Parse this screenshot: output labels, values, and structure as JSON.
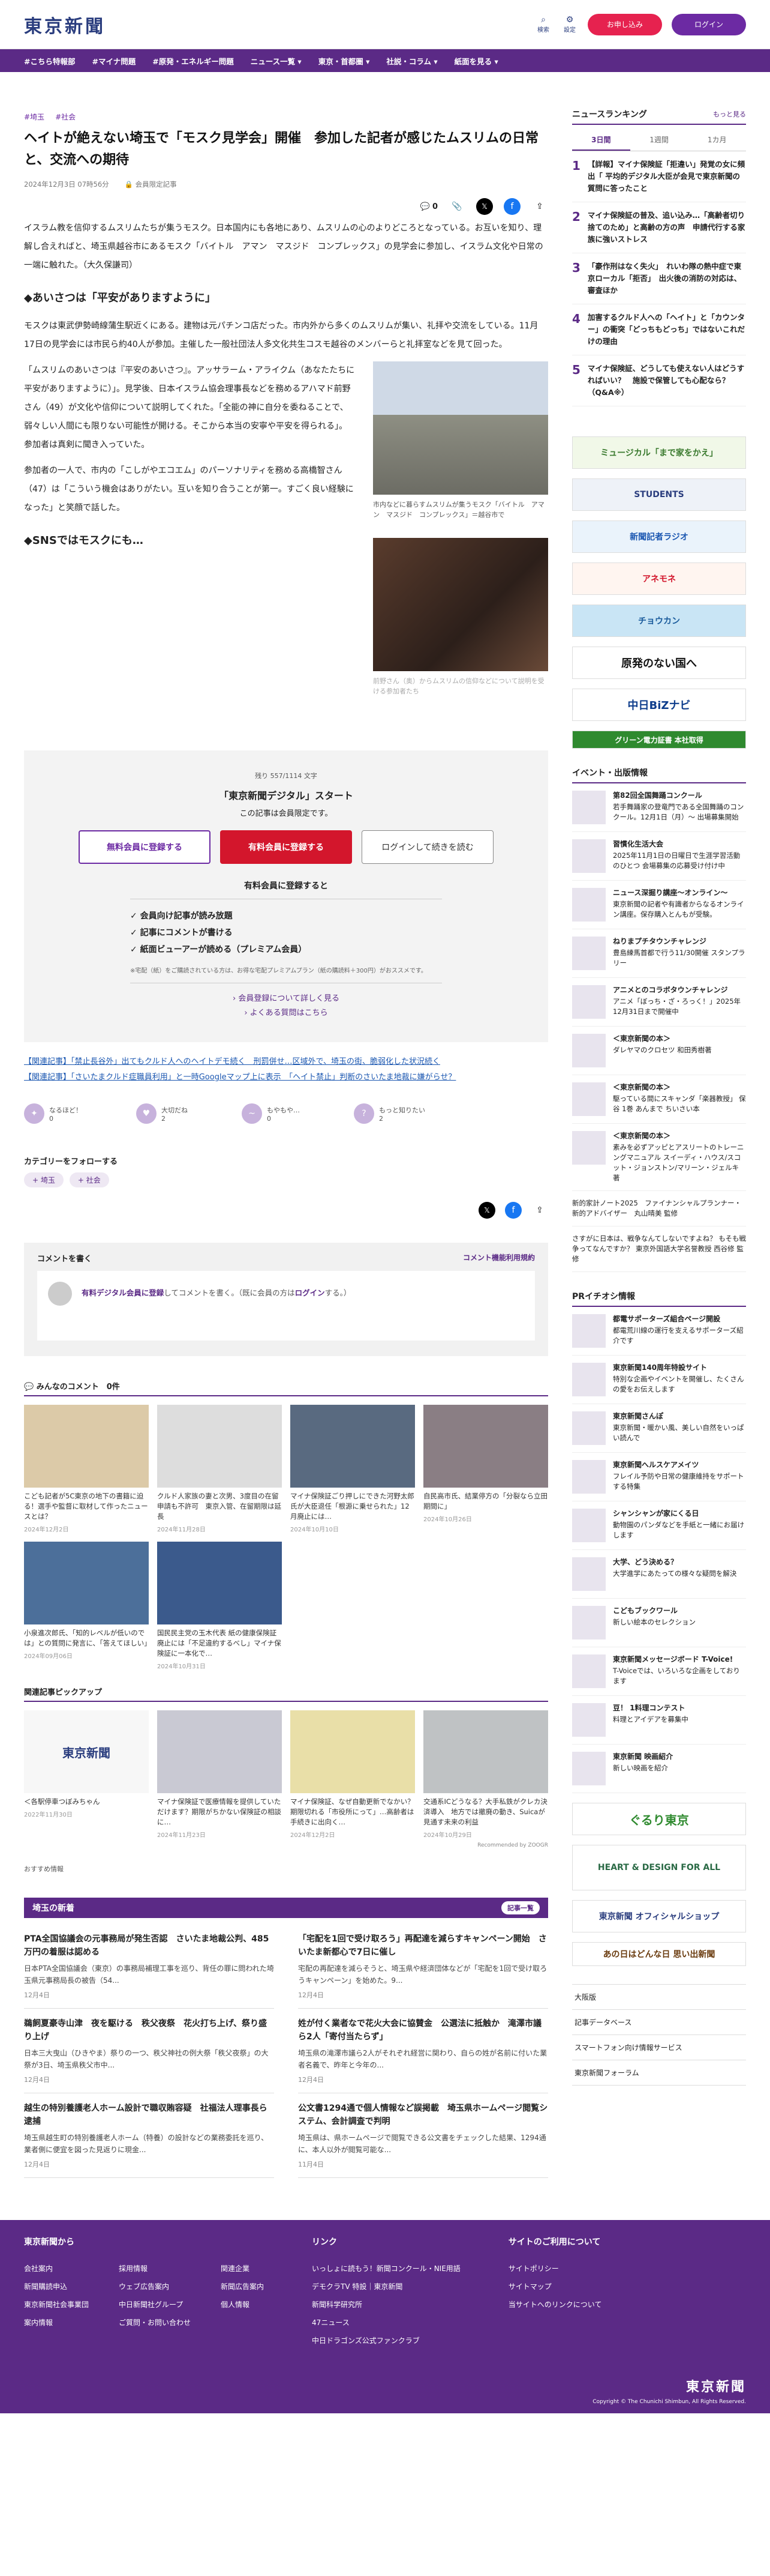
{
  "header": {
    "logo": "東京新聞",
    "search_label": "検索",
    "settings_label": "設定",
    "member_button": "お申し込み",
    "login_button": "ログイン"
  },
  "nav": [
    "#こちら特報部",
    "#マイナ問題",
    "#原発・エネルギー問題",
    "ニュース一覧 ▾",
    "東京・首都圏 ▾",
    "社説・コラム ▾",
    "紙面を見る ▾"
  ],
  "article": {
    "crumbs": [
      "#埼玉",
      "#社会"
    ],
    "title": "ヘイトが絶えない埼玉で「モスク見学会」開催　参加した記者が感じたムスリムの日常と、交流への期待",
    "date": "2024年12月3日 07時56分",
    "members_only": "会員限定記事",
    "comment_count": "0",
    "p1": "イスラム教を信仰するムスリムたちが集うモスク。日本国内にも各地にあり、ムスリムの心のよりどころとなっている。お互いを知り、理解し合えればと、埼玉県越谷市にあるモスク「バイトル　アマン　マスジド　コンプレックス」の見学会に参加し、イスラム文化や日常の一端に触れた。（大久保謙司）",
    "h1": "◆あいさつは「平安がありますように」",
    "p2": "モスクは東武伊勢崎線蒲生駅近くにある。建物は元パチンコ店だった。市内外から多くのムスリムが集い、礼拝や交流をしている。11月17日の見学会には市民ら約40人が参加。主催した一般社団法人多文化共生コスモ越谷のメンバーらと礼拝室などを見て回った。",
    "p3": "「ムスリムのあいさつは『平安のあいさつ』。アッサラーム・アライクム（あなたたちに平安がありますように）」。見学後、日本イスラム協会理事長などを務めるアハマド前野さん（49）が文化や信仰について説明してくれた。「全能の神に自分を委ねることで、弱々しい人間にも限りない可能性が開ける。そこから本当の安寧や平安を得られる」。参加者は真剣に聞き入っていた。",
    "p4": "参加者の一人で、市内の「こしがやエコエム」のパーソナリティを務める高橋智さん（47）は「こういう機会はありがたい。互いを知り合うことが第一。すごく良い経験になった」と笑顔で話した。",
    "h2": "◆SNSではモスクにも…",
    "cap1": "市内などに暮らすムスリムが集うモスク「バイトル　アマン　マスジド　コンプレックス」＝越谷市で",
    "cap2": "前野さん（奥）からムスリムの信仰などについて説明を受ける参加者たち"
  },
  "paywall": {
    "count": "残り 557/1114 文字",
    "title": "「東京新聞デジタル」スタート",
    "sub": "この記事は会員限定です。",
    "btn_free": "無料会員に登録する",
    "btn_paid": "有料会員に登録する",
    "btn_login": "ログインして続きを読む",
    "benefit_title": "有料会員に登録すると",
    "benefits": [
      "✓ 会員向け記事が読み放題",
      "✓ 記事にコメントが書ける",
      "✓ 紙面ビューアーが読める（プレミアム会員）"
    ],
    "note": "※宅配（紙）をご購読されている方は、お得な宅配プレミアムプラン（紙の購読料＋300円）がおススメです。",
    "link1": "› 会員登録について詳しく見る",
    "link2": "› よくある質問はこちら"
  },
  "related": [
    "【関連記事】「禁止長谷外」出てもクルド人へのヘイトデモ続く　刑罰併せ…区域外で、埼玉の街、脆弱化した状況続く",
    "【関連記事】「さいたまクルド症職員利用」と一時Googleマップ上に表示　「ヘイト禁止」判断のさいたま地裁に嫌がらせ？"
  ],
  "reactions": [
    {
      "label": "なるほど！",
      "count": "0"
    },
    {
      "label": "大切だね",
      "count": "2"
    },
    {
      "label": "もやもや…",
      "count": "0"
    },
    {
      "label": "もっと知りたい",
      "count": "2"
    }
  ],
  "category": {
    "title": "カテゴリーをフォローする",
    "tags": [
      "+ 埼玉",
      "+ 社会"
    ]
  },
  "comment": {
    "title": "コメントを書く",
    "rules": "コメント機能利用規約",
    "prompt_link": "有料デジタル会員に登録",
    "prompt_rest": "してコメントを書く。（既に会員の方は",
    "prompt_login": "ログイン",
    "prompt_end": "する。）"
  },
  "everyone": {
    "title": "みんなのコメント　0件"
  },
  "cards": [
    {
      "t": "こども記者が5C東京の地下の書籍に迫る！選手や監督に取材して作ったニュースとは？",
      "d": "2024年12月2日"
    },
    {
      "t": "クルド人家族の妻と次男、3度目の在留申請も不許可　東京入管、在留期限は延長",
      "d": "2024年11月28日"
    },
    {
      "t": "マイナ保険証ごり押しにできた河野太郎氏が大臣退任「根源に乗せられた」12月廃止には…",
      "d": "2024年10月10日"
    },
    {
      "t": "自民高市氏、結業停方の「分裂なら立田期間に」",
      "d": "2024年10月26日"
    },
    {
      "t": "小泉進次郎氏、「知的レベルが低いのでは」との質問に発言に、「答えてほしい」",
      "d": "2024年09月06日"
    },
    {
      "t": "国民民主党の玉木代表 紙の健康保険証廃止には「不足違約するべし」マイナ保険証に一本化で…",
      "d": "2024年10月31日"
    }
  ],
  "pickup": {
    "title": "関連記事ピックアップ",
    "cards": [
      {
        "t": "＜各駅停車つぼみちゃん",
        "d": "2022年11月30日"
      },
      {
        "t": "マイナ保険証で医療情報を提供していただけます？期限がちかない保険証の相談に…",
        "d": "2024年11月23日"
      },
      {
        "t": "マイナ保険証、なぜ自動更新でなかい？期限切れる「市役所にって」…高齢者は手続きに出向く…",
        "d": "2024年12月2日"
      },
      {
        "t": "交通系ICどうなる？大手私鉄がクレカ決済導入　地方では撤廃の動き、Suicaが見通す未来の利益",
        "d": "2024年10月29日"
      }
    ],
    "logo": "東京新聞",
    "rec": "Recommended by ZOOGR"
  },
  "osusume": "おすすめ情報",
  "sainews": {
    "title": "埼玉の新着",
    "more": "記事一覧",
    "items": [
      {
        "h": "PTA全国協議会の元事務局が発生否認　さいたま地裁公判、485万円の着服は認める",
        "p": "日本PTA全国協議会（東京）の事務局補理工事を巡り、背任の罪に問われた埼玉県元事務局長の被告（54...",
        "d": "12月4日"
      },
      {
        "h": "「宅配を1回で受け取ろう」再配達を減らすキャンペーン開始　さいたま新都心で7日に催し",
        "p": "宅配の再配達を減らそうと、埼玉県や経済団体などが「宅配を1回で受け取ろうキャンペーン」を始めた。9...",
        "d": "12月4日"
      },
      {
        "h": "鵜飼夏豪寺山津　夜を駆ける　秩父夜祭　花火打ち上げ、祭り盛り上げ",
        "p": "日本三大曳山（ひきやま）祭りの一つ、秩父神社の例大祭「秩父夜祭」の大祭が3日、埼玉県秩父市中...",
        "d": "12月4日"
      },
      {
        "h": "姓が付く業者なで花火大会に協賛金　公選法に抵触か　滝澤市議ら2人「寄付当たらず」",
        "p": "埼玉県の滝澤市議ら2人がそれぞれ経営に関わり、自らの姓が名前に付いた業者名義で、昨年と今年の...",
        "d": "12月4日"
      },
      {
        "h": "越生の特別養護老人ホーム設計で職収賄容疑　社福法人理事長ら逮捕",
        "p": "埼玉県越生町の特別養護老人ホーム（特養）の設計などの業務委託を巡り、業者側に便宜を図った見返りに現金...",
        "d": "12月4日"
      },
      {
        "h": "公文書1294通で個人情報など誤掲載　埼玉県ホームページ閲覧システム、会計調査で判明",
        "p": "埼玉県は、県ホームページで閲覧できる公文書をチェックした結果、1294通に、本人以外が閲覧可能な...",
        "d": "11月4日"
      }
    ]
  },
  "ranking": {
    "title": "ニュースランキング",
    "more": "もっと見る",
    "tabs": [
      "3日間",
      "1週間",
      "1カ月"
    ],
    "items": [
      "【詳報】マイナ保険証「拒違い」発覚の女に頻出「 平均的デジタル大臣が会見で東京新聞の質問に答ったこと",
      "マイナ保険証の普及、追い込み…「高齢者切り捨てのため」と高齢の方の声　申請代行する家族に強いストレス",
      "「豪作刑はなく失火」　れいわ隊の熱中症で東京ローカル「拒否」　出火後の消防の対応は、審査ほか",
      "加害するクルド人への「ヘイト」と「カウンター」の衝突「どっちもどっち」ではないこれだけの理由",
      "マイナ保険証、どうしても使えない人はどうすればいい？　施設で保管しても心配なら？（Q&A※）"
    ]
  },
  "banners": [
    "ミュージカル「まで家をかえ」",
    "STUDENTS",
    "新聞記者ラジオ",
    "アネモネ",
    "チョウカン",
    "原発のない国へ",
    "中日BiZナビ",
    "グリーン電力証書 本社取得"
  ],
  "events": {
    "title": "イベント・出版情報",
    "items": [
      {
        "b": "第82回全国舞踊コンクール",
        "t": "若手舞踊家の登竜門である全国舞踊のコンクール。12月1日（月）～ 出場募集開始"
      },
      {
        "b": "習慣化生活大会",
        "t": "2025年11月1日の日曜日で生涯学習活動のひとつ 会場募集の応募受け付け中"
      },
      {
        "b": "ニュース深掘り講座～オンライン～",
        "t": "東京新聞の記者や有識者からなるオンライン講座。保存購入とんもが受験。"
      },
      {
        "b": "ねりまプチタウンチャレンジ",
        "t": "豊島練馬首都で行う11/30開催 スタンプラリー"
      },
      {
        "b": "アニメとのコラボタウンチャレンジ",
        "t": "アニメ「ぼっち・ざ・ろっく！」2025年12月31日まで開催中"
      },
      {
        "b": "＜東京新聞の本＞",
        "t": "ダレヤマのクロセツ 和田秀樹著"
      },
      {
        "b": "＜東京新聞の本＞",
        "t": "駆っている間にスキャンダ「楽器教授」 保谷 1巻 あんまで ちいさい本"
      },
      {
        "b": "＜東京新聞の本＞",
        "t": "素みを必ずアッピとアスリートのトレーニングマニュアル スイーディ・ハウス/スコット・ジョンストン/マリーン・ジェルキ 著"
      }
    ]
  },
  "side_text": [
    "新的家計ノート2025　ファイナンシャルプランナー・新的アドバイザー　丸山晴美 監修",
    "さすがに日本は、戦争なんてしないですよね？ もそも戦争ってなんですか？ 東京外国語大学名誉教授 西谷修 監修"
  ],
  "pr": {
    "title": "PRイチオシ情報",
    "items": [
      {
        "b": "都電サポーターズ組合ページ開設",
        "t": "都電荒川線の運行を支えるサポーターズ紹介です"
      },
      {
        "b": "東京新聞140周年特設サイト",
        "t": "特別な企画やイベントを開催し、たくさんの愛をお伝えします"
      },
      {
        "b": "東京新聞さんぽ",
        "t": "東京新聞・暖かい風、美しい自然をいっぱい読んで"
      },
      {
        "b": "東京新聞へルスケアメイツ",
        "t": "フレイル予防や日常の健康維持をサポートする特集"
      },
      {
        "b": "シャンシャンが家にくる日",
        "t": "動物園のパンダなどを手紙と一緒にお届けします"
      },
      {
        "b": "大学、どう決める？",
        "t": "大学進学にあたっての様々な疑問を解決"
      },
      {
        "b": "こどもブックワール",
        "t": "新しい絵本のセレクション"
      },
      {
        "b": "東京新聞メッセージボード T-Voice!",
        "t": "T-Voiceでは、いろいろな企画をしております"
      },
      {
        "b": "豆！ 1料理コンテスト",
        "t": "料理とアイデアを募集中"
      },
      {
        "b": "東京新聞 映画紹介",
        "t": "新しい映画を紹介"
      }
    ]
  },
  "side_banners": [
    "ぐるり東京",
    "HEART & DESIGN FOR ALL",
    "東京新聞 オフィシャルショップ",
    "あの日はどんな日 思い出新聞"
  ],
  "side_links": [
    "大阪版",
    "記事データベース",
    "スマートフォン向け情報サービス",
    "東京新聞フォーラム"
  ],
  "footer": {
    "col1_title": "東京新聞から",
    "col1": [
      "会社案内",
      "新聞購読申込",
      "東京新聞社会事業団",
      "案内情報"
    ],
    "col2": [
      "採用情報",
      "ウェブ広告案内",
      "中日新聞社グループ",
      "ご質問・お問い合わせ"
    ],
    "col3": [
      "関連企業",
      "新聞広告案内",
      "個人情報"
    ],
    "col4_title": "リンク",
    "col4": [
      "いっしょに読もう！新聞コンクール・NIE用語",
      "デモクラTV 特設｜東京新聞",
      "新聞科学研究所",
      "47ニュース",
      "中日ドラゴンズ公式ファンクラブ"
    ],
    "col5_title": "サイトのご利用について",
    "col5": [
      "サイトポリシー",
      "サイトマップ",
      "当サイトへのリンクについて"
    ],
    "logo": "東京新聞",
    "copy": "Copyright © The Chunichi Shimbun, All Rights Reserved."
  }
}
